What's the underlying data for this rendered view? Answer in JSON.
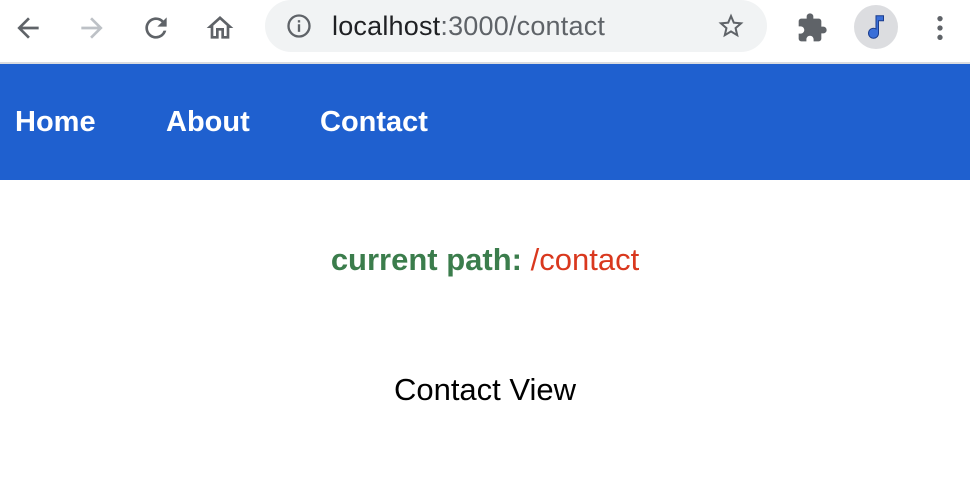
{
  "browser": {
    "url_host": "localhost",
    "url_rest": ":3000/contact",
    "icons": [
      "back-icon",
      "forward-icon",
      "reload-icon",
      "home-icon",
      "info-icon",
      "star-icon",
      "puzzle-icon",
      "music-note-icon",
      "kebab-menu-icon"
    ]
  },
  "nav": {
    "items": [
      {
        "label": "Home"
      },
      {
        "label": "About"
      },
      {
        "label": "Contact"
      }
    ]
  },
  "main": {
    "path_label": "current path:",
    "path_value": "/contact",
    "view_title": "Contact View"
  },
  "colors": {
    "navbar": "#1f60cf",
    "path_label": "#3b7d4c",
    "path_value": "#d9381e"
  }
}
